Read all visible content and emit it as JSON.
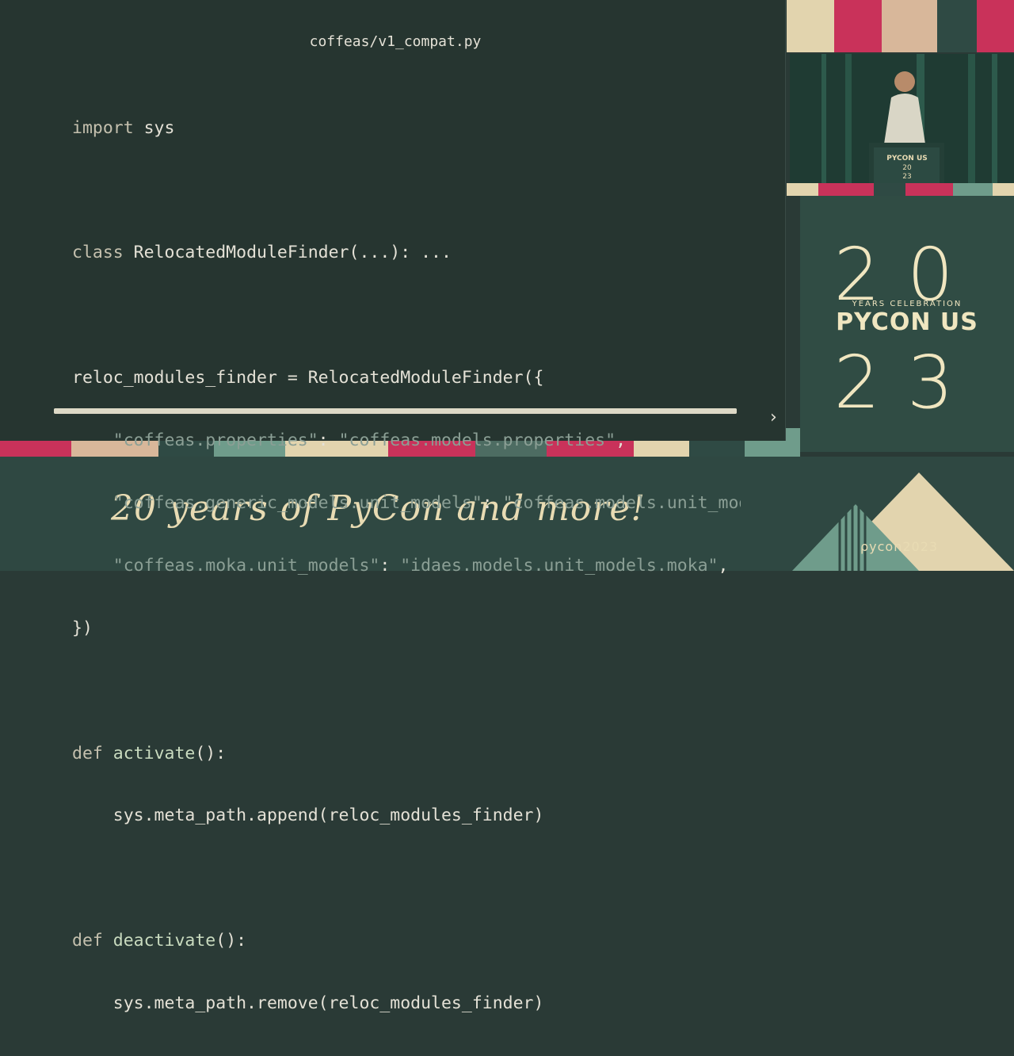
{
  "slide": {
    "file_title": "coffeas/v1_compat.py",
    "code": {
      "line1": {
        "kw": "import",
        "rest": " sys"
      },
      "line2": {
        "kw": "class",
        "rest": " RelocatedModuleFinder(...): ..."
      },
      "line3": {
        "text": "reloc_modules_finder = RelocatedModuleFinder({"
      },
      "line4": {
        "k": "\"coffeas.properties\"",
        "sep": ": ",
        "v": "\"coffeas.models.properties\"",
        "end": ","
      },
      "line5": {
        "k": "\"coffeas.generic_models.unit_models\"",
        "sep": ": ",
        "v": "\"coffeas.models.unit_models\"",
        "end": ","
      },
      "line6": {
        "k": "\"coffeas.moka.unit_models\"",
        "sep": ": ",
        "v": "\"idaes.models.unit_models.moka\"",
        "end": ","
      },
      "line7": {
        "text": "})"
      },
      "line8": {
        "kw": "def",
        "fn": "activate",
        "rest": "():"
      },
      "line9": {
        "text": "sys.meta_path.append(reloc_modules_finder)"
      },
      "line10": {
        "kw": "def",
        "fn": "deactivate",
        "rest": "():"
      },
      "line11": {
        "text": "sys.meta_path.remove(reloc_modules_finder)"
      }
    },
    "next_icon": "chevron-right-icon"
  },
  "logo": {
    "top": "20",
    "subtitle": "YEARS CELEBRATION",
    "name": "PYCON US",
    "bottom": "23"
  },
  "footer": {
    "tagline": "20 years of PyCon and more!",
    "sponsor_logo": "ρycon2023"
  },
  "colors": {
    "slide_bg": "#263530",
    "accent_pink": "#c9325a",
    "accent_cream": "#f0e6c0",
    "accent_teal": "#6f9c8b"
  }
}
